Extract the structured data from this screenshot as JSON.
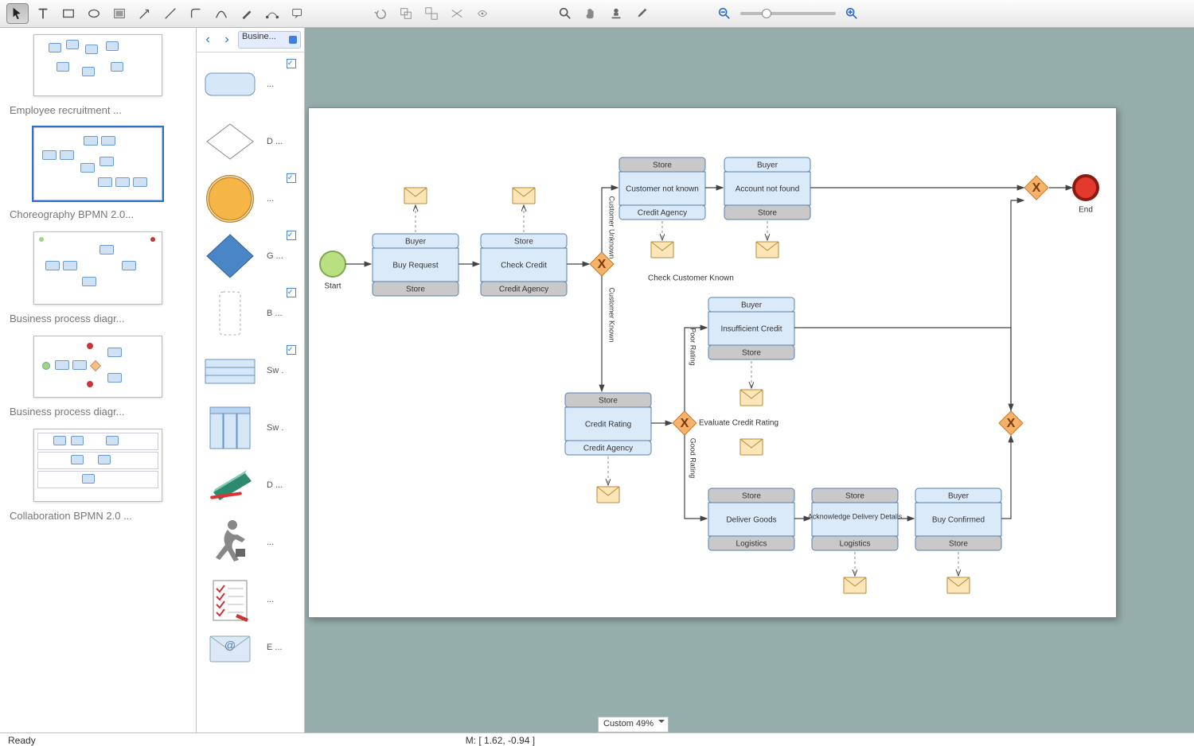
{
  "toolbar": {
    "tools": [
      "pointer",
      "text-cursor",
      "rect",
      "ellipse",
      "image",
      "arrow",
      "line",
      "connector",
      "curve",
      "pen",
      "node-edit",
      "callout"
    ],
    "edit_tools": [
      "undo",
      "group",
      "ungroup",
      "flip",
      "rotate"
    ],
    "view_tools": [
      "search",
      "hand",
      "stamp",
      "eyedropper"
    ],
    "zoom": {
      "out_icon": "zoom-out",
      "in_icon": "zoom-in",
      "value": 25
    }
  },
  "thumbnails": [
    {
      "label": "Employee recruitment ..."
    },
    {
      "label": "Choreography BPMN 2.0..."
    },
    {
      "label": "Business process diagr..."
    },
    {
      "label": "Business process diagr..."
    },
    {
      "label": "Collaboration BPMN 2.0 ..."
    }
  ],
  "library": {
    "nav_back": "‹",
    "nav_fwd": "›",
    "selected": "Busine...",
    "items": [
      {
        "shape": "rounded-rect",
        "label": "..."
      },
      {
        "shape": "diamond",
        "label": "D ..."
      },
      {
        "shape": "circle-orange",
        "label": "..."
      },
      {
        "shape": "diamond-blue",
        "label": "G ..."
      },
      {
        "shape": "dashed-rect",
        "label": "B ..."
      },
      {
        "shape": "swimlane-h",
        "label": "Sw ."
      },
      {
        "shape": "swimlane-v",
        "label": "Sw ."
      },
      {
        "shape": "notebook",
        "label": "D ..."
      },
      {
        "shape": "running-man",
        "label": "..."
      },
      {
        "shape": "clipboard",
        "label": "..."
      },
      {
        "shape": "mail-blue",
        "label": "E ..."
      }
    ]
  },
  "diagram": {
    "start_label": "Start",
    "end_label": "End",
    "gateways": {
      "g1": "Check Customer Known",
      "g2": "Evaluate Credit Rating"
    },
    "edges": {
      "unknown": "Customer Unknown",
      "known": "Customer Known",
      "poor": "Poor Rating",
      "good": "Good Rating"
    },
    "tasks": {
      "buy_request": {
        "top": "Buyer",
        "mid": "Buy Request",
        "bot": "Store"
      },
      "check_credit": {
        "top": "Store",
        "mid": "Check Credit",
        "bot": "Credit Agency"
      },
      "cust_not_known": {
        "top": "Store",
        "mid": "Customer not known",
        "bot": "Credit Agency"
      },
      "acct_not_found": {
        "top": "Buyer",
        "mid": "Account not found",
        "bot": "Store"
      },
      "credit_rating": {
        "top": "Store",
        "mid": "Credit Rating",
        "bot": "Credit Agency"
      },
      "insufficient": {
        "top": "Buyer",
        "mid": "Insufficient Credit",
        "bot": "Store"
      },
      "deliver": {
        "top": "Store",
        "mid": "Deliver Goods",
        "bot": "Logistics"
      },
      "ack": {
        "top": "Store",
        "mid": "Acknowledge Delivery Details",
        "bot": "Logistics"
      },
      "confirm": {
        "top": "Buyer",
        "mid": "Buy Confirmed",
        "bot": "Store"
      }
    }
  },
  "zoom_combo": "Custom 49%",
  "status": {
    "ready": "Ready",
    "mouse": "M: [ 1.62, -0.94 ]"
  }
}
